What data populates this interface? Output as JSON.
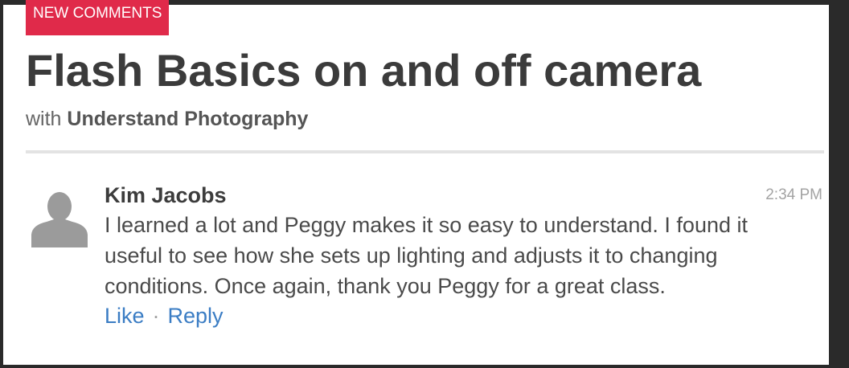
{
  "badge": {
    "label": "NEW COMMENTS"
  },
  "course": {
    "title": "Flash Basics on and off camera",
    "byline_prefix": "with",
    "author": "Understand Photography"
  },
  "comment": {
    "author": "Kim Jacobs",
    "time": "2:34 PM",
    "lines": [
      "I learned a lot and Peggy makes it so easy to understand. I found it",
      "useful to see how she sets up lighting and adjusts it to changing",
      "conditions. Once again, thank you Peggy for a great class."
    ],
    "actions": {
      "like": "Like",
      "separator": "·",
      "reply": "Reply"
    }
  },
  "colors": {
    "badge": "#e02a4a",
    "link": "#3b7dc4",
    "title": "#3b3b3b",
    "avatar": "#9b9b9b"
  },
  "icons": {
    "avatar": "user-silhouette-icon"
  }
}
